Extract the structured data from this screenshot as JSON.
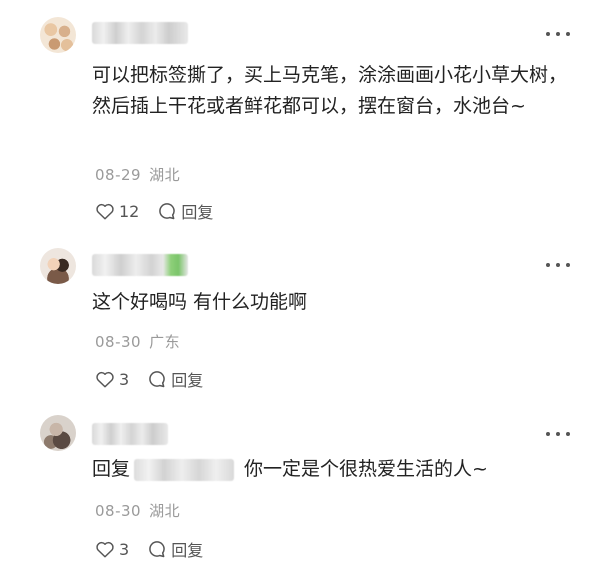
{
  "comments": [
    {
      "text": "可以把标签撕了，买上马克笔，涂涂画画小花小草大树，然后插上干花或者鲜花都可以，摆在窗台，水池台~",
      "date": "08-29",
      "location": "湖北",
      "likes": "12",
      "reply_label": "回复"
    },
    {
      "text": "这个好喝吗 有什么功能啊",
      "date": "08-30",
      "location": "广东",
      "likes": "3",
      "reply_label": "回复"
    },
    {
      "reply_prefix": "回复",
      "text": "你一定是个很热爱生活的人~",
      "date": "08-30",
      "location": "湖北",
      "likes": "3",
      "reply_label": "回复"
    }
  ],
  "colors": {
    "text": "#222222",
    "meta": "#9a9a9a",
    "icon": "#555555",
    "background": "#ffffff"
  },
  "icons": {
    "more": "more-dots-icon",
    "like": "heart-icon",
    "reply": "comment-bubble-icon"
  }
}
